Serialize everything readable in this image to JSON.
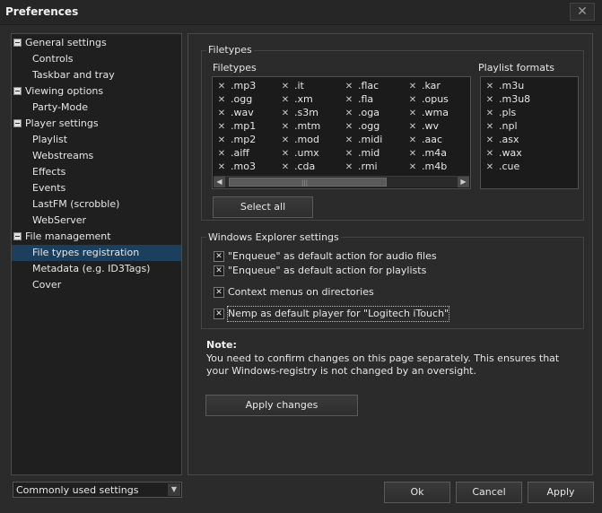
{
  "window": {
    "title": "Preferences",
    "close_glyph": "✕"
  },
  "tree": {
    "items": [
      {
        "label": "General settings",
        "level": 0,
        "expander": true
      },
      {
        "label": "Controls",
        "level": 1
      },
      {
        "label": "Taskbar and tray",
        "level": 1
      },
      {
        "label": "Viewing options",
        "level": 0,
        "expander": true
      },
      {
        "label": "Party-Mode",
        "level": 1
      },
      {
        "label": "Player settings",
        "level": 0,
        "expander": true
      },
      {
        "label": "Playlist",
        "level": 1
      },
      {
        "label": "Webstreams",
        "level": 1
      },
      {
        "label": "Effects",
        "level": 1
      },
      {
        "label": "Events",
        "level": 1
      },
      {
        "label": "LastFM (scrobble)",
        "level": 1
      },
      {
        "label": "WebServer",
        "level": 1
      },
      {
        "label": "File management",
        "level": 0,
        "expander": true
      },
      {
        "label": "File types registration",
        "level": 1,
        "selected": true
      },
      {
        "label": "Metadata (e.g. ID3Tags)",
        "level": 1
      },
      {
        "label": "Cover",
        "level": 1
      }
    ]
  },
  "filetypes_group": {
    "title": "Filetypes",
    "filetypes_label": "Filetypes",
    "playlist_label": "Playlist formats",
    "check_glyph": "✕",
    "columns": [
      [
        ".mp3",
        ".ogg",
        ".wav",
        ".mp1",
        ".mp2",
        ".aiff",
        ".mo3"
      ],
      [
        ".it",
        ".xm",
        ".s3m",
        ".mtm",
        ".mod",
        ".umx",
        ".cda"
      ],
      [
        ".flac",
        ".fla",
        ".oga",
        ".ogg",
        ".midi",
        ".mid",
        ".rmi"
      ],
      [
        ".kar",
        ".opus",
        ".wma",
        ".wv",
        ".aac",
        ".m4a",
        ".m4b"
      ]
    ],
    "playlist_formats": [
      ".m3u",
      ".m3u8",
      ".pls",
      ".npl",
      ".asx",
      ".wax",
      ".cue"
    ],
    "scroll": {
      "left": "◀",
      "right": "▶",
      "grip": "|||"
    },
    "select_all": "Select all"
  },
  "explorer_group": {
    "title": "Windows Explorer settings",
    "options": [
      {
        "label": "\"Enqueue\" as default action for audio files",
        "checked": true
      },
      {
        "label": "\"Enqueue\" as default action for playlists",
        "checked": true
      },
      {
        "label": "Context menus on directories",
        "checked": true
      },
      {
        "label": "Nemp as default player for \"Logitech iTouch\"",
        "checked": true
      }
    ]
  },
  "note": {
    "title": "Note:",
    "text": "You need to confirm changes on this page separately. This ensures that your Windows-registry is not changed by an oversight."
  },
  "apply_changes": "Apply changes",
  "bottom": {
    "combo_value": "Commonly used settings",
    "combo_arrow": "▼",
    "ok": "Ok",
    "cancel": "Cancel",
    "apply": "Apply"
  }
}
